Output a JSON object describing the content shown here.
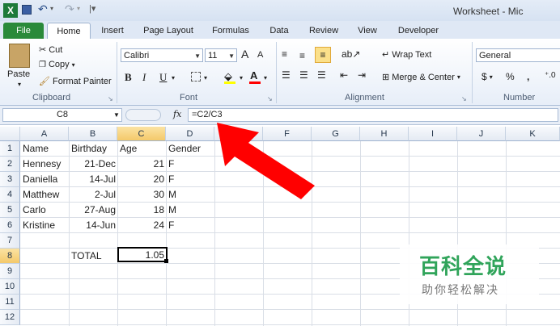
{
  "window": {
    "title": "Worksheet - Mic"
  },
  "quick_access": {
    "icons": [
      "excel-icon",
      "save-icon",
      "undo-icon",
      "redo-icon",
      "customize-icon"
    ]
  },
  "tabs": [
    {
      "label": "File",
      "active": false
    },
    {
      "label": "Home",
      "active": true
    },
    {
      "label": "Insert"
    },
    {
      "label": "Page Layout"
    },
    {
      "label": "Formulas"
    },
    {
      "label": "Data"
    },
    {
      "label": "Review"
    },
    {
      "label": "View"
    },
    {
      "label": "Developer"
    }
  ],
  "ribbon": {
    "clipboard": {
      "paste": "Paste",
      "cut": "Cut",
      "copy": "Copy",
      "format_painter": "Format Painter",
      "group": "Clipboard"
    },
    "font": {
      "name": "Calibri",
      "size": "11",
      "bold": "B",
      "italic": "I",
      "underline": "U",
      "grow": "A",
      "shrink": "A",
      "font_color": "A",
      "group": "Font",
      "accent_color": "#ff0000",
      "highlight_color": "#ffff00"
    },
    "alignment": {
      "wrap_text": "Wrap Text",
      "merge_center": "Merge & Center",
      "group": "Alignment"
    },
    "number": {
      "format": "General",
      "currency": "$",
      "percent": "%",
      "comma": ",",
      "group": "Number"
    }
  },
  "formula_bar": {
    "name_box": "C8",
    "fx": "fx",
    "formula": "=C2/C3"
  },
  "columns": [
    "A",
    "B",
    "C",
    "D",
    "E",
    "F",
    "G",
    "H",
    "I",
    "J",
    "K"
  ],
  "rows": [
    "1",
    "2",
    "3",
    "4",
    "5",
    "6",
    "7",
    "8",
    "9",
    "10",
    "11",
    "12"
  ],
  "active_cell": "C8",
  "cells": {
    "A1": "Name",
    "B1": "Birthday",
    "C1": "Age",
    "D1": "Gender",
    "A2": "Hennesy",
    "B2": "21-Dec",
    "C2": "21",
    "D2": "F",
    "A3": "Daniella",
    "B3": "14-Jul",
    "C3": "20",
    "D3": "F",
    "A4": "Matthew",
    "B4": "2-Jul",
    "C4": "30",
    "D4": "M",
    "A5": "Carlo",
    "B5": "27-Aug",
    "C5": "18",
    "D5": "M",
    "A6": "Kristine",
    "B6": "14-Jun",
    "C6": "24",
    "D6": "F",
    "B8": "TOTAL",
    "C8": "1.05"
  },
  "watermark": {
    "title": "百科全说",
    "subtitle": "助你轻松解决",
    "color": "#30a45a"
  },
  "colors": {
    "file_tab": "#2a8a3a",
    "header_highlight": "#f4c96a",
    "arrow": "#ff0000"
  }
}
